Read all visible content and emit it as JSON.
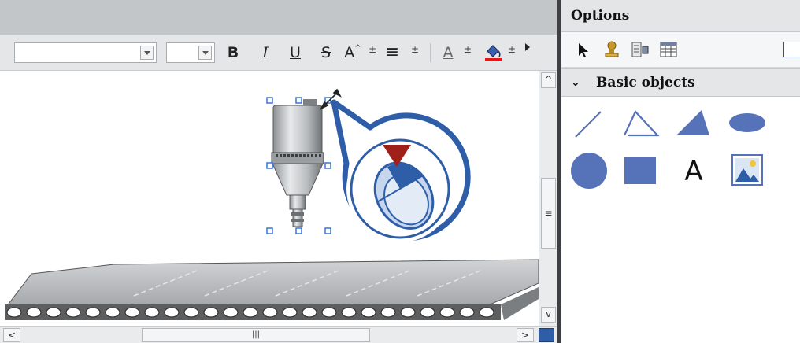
{
  "toolbar": {
    "font_combo_value": "",
    "size_combo_value": "",
    "bold_label": "B",
    "italic_label": "I",
    "underline_label": "U",
    "strike_label": "S",
    "fontsize_label": "A",
    "align_label": "≡",
    "fontcolor_label": "A",
    "plusminus": "±"
  },
  "editor": {
    "grip_label": "≡",
    "hgrip_label": "|||",
    "scroll_up": "^",
    "scroll_down": "v",
    "scroll_left": "<",
    "scroll_right": ">"
  },
  "options": {
    "title": "Options",
    "section_label": "Basic objects",
    "objects": [
      "line-icon",
      "polyline-icon",
      "polygon-icon",
      "ellipse-icon",
      "circle-icon",
      "rectangle-icon",
      "text-field-icon",
      "graphic-view-icon"
    ],
    "text_tool_glyph": "A"
  },
  "colors": {
    "shape_blue": "#5672b8",
    "callout_blue": "#2f5ea8",
    "marker_red": "#9e2019"
  }
}
